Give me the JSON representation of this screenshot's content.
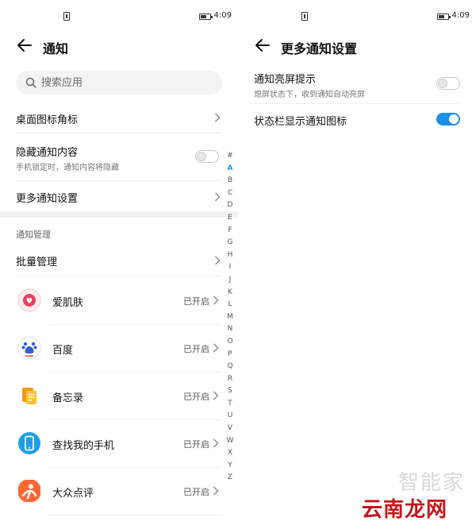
{
  "colors": {
    "accent": "#1c8fe6",
    "divider": "#ececec"
  },
  "status": {
    "time": "4:09"
  },
  "left": {
    "title": "通知",
    "search": {
      "placeholder": "搜索应用"
    },
    "rows": {
      "badge": {
        "label": "桌面图标角标"
      },
      "hide": {
        "label": "隐藏通知内容",
        "sub": "手机锁定时，通知内容将隐藏",
        "toggle": "off"
      },
      "more": {
        "label": "更多通知设置"
      }
    },
    "section_title": "通知管理",
    "batch": {
      "label": "批量管理"
    },
    "apps": [
      {
        "name": "爱肌肤",
        "status": "已开启",
        "icon": "aijifu-app-icon"
      },
      {
        "name": "百度",
        "status": "已开启",
        "icon": "baidu-app-icon"
      },
      {
        "name": "备忘录",
        "status": "已开启",
        "icon": "notes-app-icon"
      },
      {
        "name": "查找我的手机",
        "status": "已开启",
        "icon": "find-phone-app-icon"
      },
      {
        "name": "大众点评",
        "status": "已开启",
        "icon": "dianping-app-icon"
      }
    ],
    "alphabet": [
      "#",
      "A",
      "B",
      "C",
      "D",
      "E",
      "F",
      "G",
      "H",
      "I",
      "J",
      "K",
      "L",
      "M",
      "N",
      "O",
      "P",
      "Q",
      "R",
      "S",
      "T",
      "U",
      "V",
      "W",
      "X",
      "Y",
      "Z"
    ],
    "alphabet_active": "A"
  },
  "right": {
    "title": "更多通知设置",
    "rows": {
      "wake": {
        "label": "通知亮屏提示",
        "sub": "熄屏状态下，收到通知自动亮屏",
        "toggle": "off"
      },
      "statusbar": {
        "label": "状态栏显示通知图标",
        "toggle": "on"
      }
    }
  },
  "watermark": {
    "line1": "智能家",
    "line2": "云南龙网"
  }
}
